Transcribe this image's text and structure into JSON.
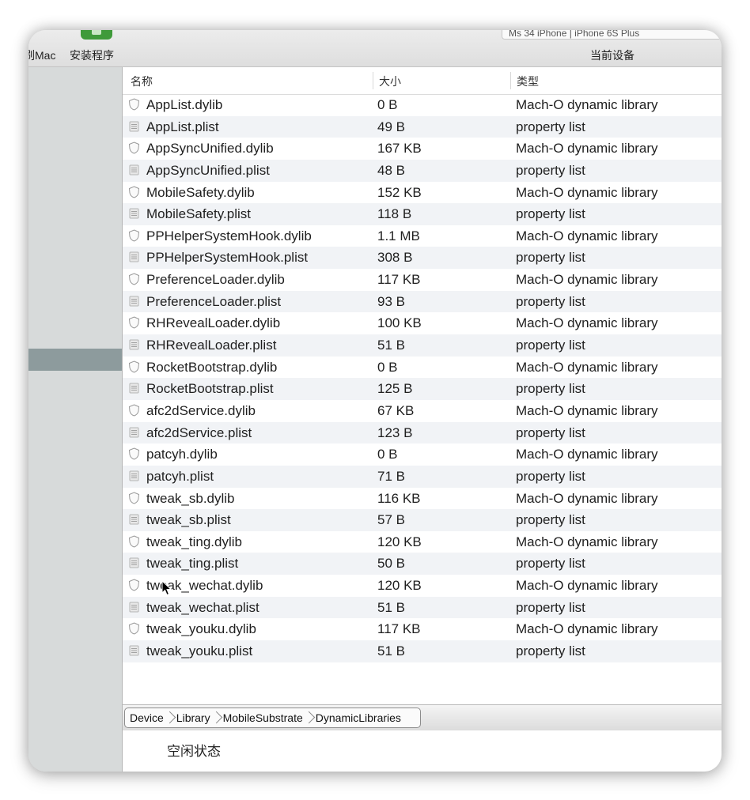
{
  "toolbar": {
    "left_label": "刷Mac",
    "installer_label": "安装程序",
    "device_select_text": "Ms 34 iPhone | iPhone 6S Plus",
    "current_device_label": "当前设备"
  },
  "columns": {
    "name": "名称",
    "size": "大小",
    "kind": "类型"
  },
  "files": [
    {
      "name": "AppList.dylib",
      "size": "0 B",
      "kind": "Mach-O dynamic library",
      "icon": "dylib-icon"
    },
    {
      "name": "AppList.plist",
      "size": "49 B",
      "kind": "property list",
      "icon": "plist-icon"
    },
    {
      "name": "AppSyncUnified.dylib",
      "size": "167 KB",
      "kind": "Mach-O dynamic library",
      "icon": "dylib-icon"
    },
    {
      "name": "AppSyncUnified.plist",
      "size": "48 B",
      "kind": "property list",
      "icon": "plist-icon"
    },
    {
      "name": "MobileSafety.dylib",
      "size": "152 KB",
      "kind": "Mach-O dynamic library",
      "icon": "dylib-icon"
    },
    {
      "name": "MobileSafety.plist",
      "size": "118 B",
      "kind": "property list",
      "icon": "plist-icon"
    },
    {
      "name": "PPHelperSystemHook.dylib",
      "size": "1.1 MB",
      "kind": "Mach-O dynamic library",
      "icon": "dylib-icon"
    },
    {
      "name": "PPHelperSystemHook.plist",
      "size": "308 B",
      "kind": "property list",
      "icon": "plist-icon"
    },
    {
      "name": "PreferenceLoader.dylib",
      "size": "117 KB",
      "kind": "Mach-O dynamic library",
      "icon": "dylib-icon"
    },
    {
      "name": "PreferenceLoader.plist",
      "size": "93 B",
      "kind": "property list",
      "icon": "plist-icon"
    },
    {
      "name": "RHRevealLoader.dylib",
      "size": "100 KB",
      "kind": "Mach-O dynamic library",
      "icon": "dylib-icon"
    },
    {
      "name": "RHRevealLoader.plist",
      "size": "51 B",
      "kind": "property list",
      "icon": "plist-icon"
    },
    {
      "name": "RocketBootstrap.dylib",
      "size": "0 B",
      "kind": "Mach-O dynamic library",
      "icon": "dylib-icon"
    },
    {
      "name": "RocketBootstrap.plist",
      "size": "125 B",
      "kind": "property list",
      "icon": "plist-icon"
    },
    {
      "name": "afc2dService.dylib",
      "size": "67 KB",
      "kind": "Mach-O dynamic library",
      "icon": "dylib-icon"
    },
    {
      "name": "afc2dService.plist",
      "size": "123 B",
      "kind": "property list",
      "icon": "plist-icon"
    },
    {
      "name": "patcyh.dylib",
      "size": "0 B",
      "kind": "Mach-O dynamic library",
      "icon": "dylib-icon"
    },
    {
      "name": "patcyh.plist",
      "size": "71 B",
      "kind": "property list",
      "icon": "plist-icon"
    },
    {
      "name": "tweak_sb.dylib",
      "size": "116 KB",
      "kind": "Mach-O dynamic library",
      "icon": "dylib-icon"
    },
    {
      "name": "tweak_sb.plist",
      "size": "57 B",
      "kind": "property list",
      "icon": "plist-icon"
    },
    {
      "name": "tweak_ting.dylib",
      "size": "120 KB",
      "kind": "Mach-O dynamic library",
      "icon": "dylib-icon"
    },
    {
      "name": "tweak_ting.plist",
      "size": "50 B",
      "kind": "property list",
      "icon": "plist-icon"
    },
    {
      "name": "tweak_wechat.dylib",
      "size": "120 KB",
      "kind": "Mach-O dynamic library",
      "icon": "dylib-icon"
    },
    {
      "name": "tweak_wechat.plist",
      "size": "51 B",
      "kind": "property list",
      "icon": "plist-icon"
    },
    {
      "name": "tweak_youku.dylib",
      "size": "117 KB",
      "kind": "Mach-O dynamic library",
      "icon": "dylib-icon"
    },
    {
      "name": "tweak_youku.plist",
      "size": "51 B",
      "kind": "property list",
      "icon": "plist-icon"
    }
  ],
  "path": [
    "Device",
    "Library",
    "MobileSubstrate",
    "DynamicLibraries"
  ],
  "status": "空闲状态",
  "colors": {
    "row_alt": "#f1f3f6",
    "sidebar": "#d7dada",
    "sidebar_selected": "#8d9b9d",
    "app_icon": "#3f9a3a"
  }
}
